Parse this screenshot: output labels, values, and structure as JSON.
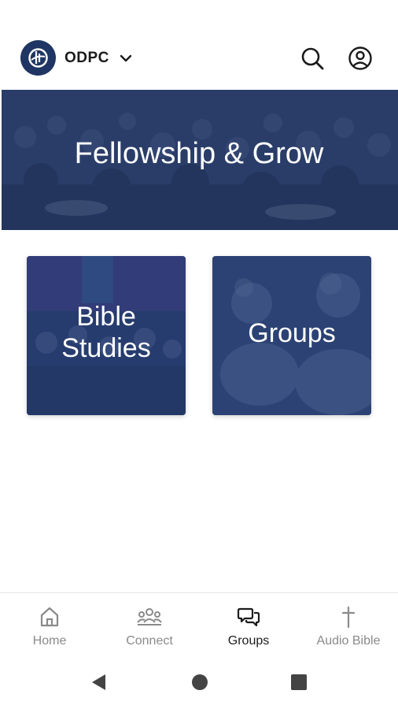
{
  "header": {
    "org_name": "ODPC",
    "logo_icon": "church-logo-icon",
    "brand_color": "#1f3563"
  },
  "hero": {
    "title": "Fellowship & Grow"
  },
  "tiles": [
    {
      "label_line1": "Bible",
      "label_line2": "Studies"
    },
    {
      "label": "Groups"
    }
  ],
  "bottom_nav": {
    "items": [
      {
        "label": "Home",
        "icon": "home-icon",
        "active": false
      },
      {
        "label": "Connect",
        "icon": "people-icon",
        "active": false
      },
      {
        "label": "Groups",
        "icon": "chat-bubbles-icon",
        "active": true
      },
      {
        "label": "Audio Bible",
        "icon": "cross-icon",
        "active": false
      }
    ]
  },
  "system_nav": {
    "icons": [
      "back-icon",
      "home-circle-icon",
      "recents-icon"
    ]
  }
}
